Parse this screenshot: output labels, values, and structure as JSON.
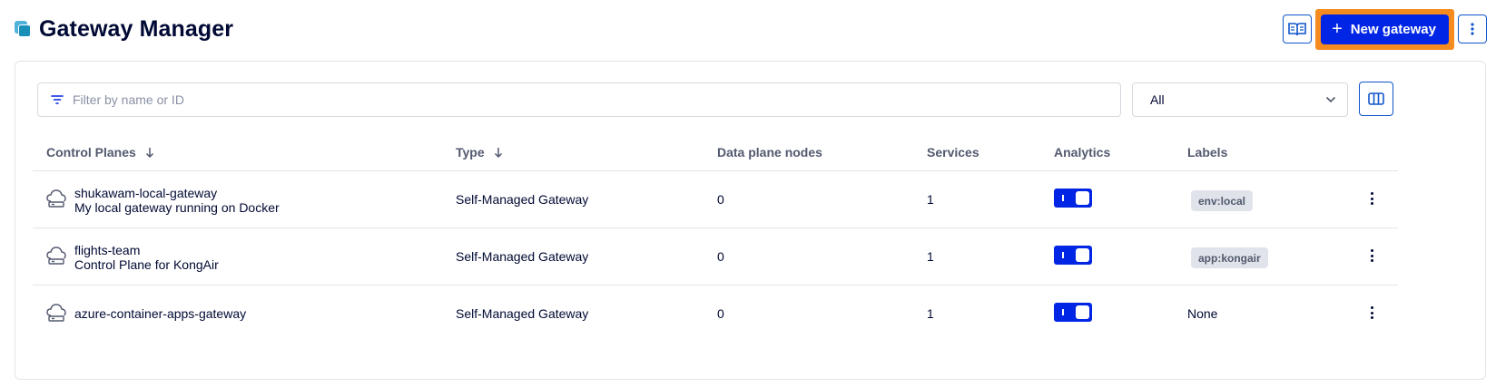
{
  "header": {
    "title": "Gateway Manager",
    "new_button_label": "New gateway"
  },
  "filters": {
    "search_placeholder": "Filter by name or ID",
    "select_value": "All"
  },
  "table": {
    "columns": [
      "Control Planes",
      "Type",
      "Data plane nodes",
      "Services",
      "Analytics",
      "Labels"
    ],
    "rows": [
      {
        "name": "shukawam-local-gateway",
        "description": "My local gateway running on Docker",
        "type": "Self-Managed Gateway",
        "data_plane_nodes": "0",
        "services": "1",
        "analytics_enabled": true,
        "label": "env:local"
      },
      {
        "name": "flights-team",
        "description": "Control Plane for KongAir",
        "type": "Self-Managed Gateway",
        "data_plane_nodes": "0",
        "services": "1",
        "analytics_enabled": true,
        "label": "app:kongair"
      },
      {
        "name": "azure-container-apps-gateway",
        "description": "",
        "type": "Self-Managed Gateway",
        "data_plane_nodes": "0",
        "services": "1",
        "analytics_enabled": true,
        "label": "None"
      }
    ]
  },
  "colors": {
    "accent": "#0025e4",
    "highlight": "#f68b1f",
    "border": "#e0e4ea"
  },
  "icons": {
    "docs": "book-icon",
    "more": "kebab-icon",
    "filter": "filter-icon",
    "columns": "columns-icon",
    "row": "cloud-server-icon"
  }
}
